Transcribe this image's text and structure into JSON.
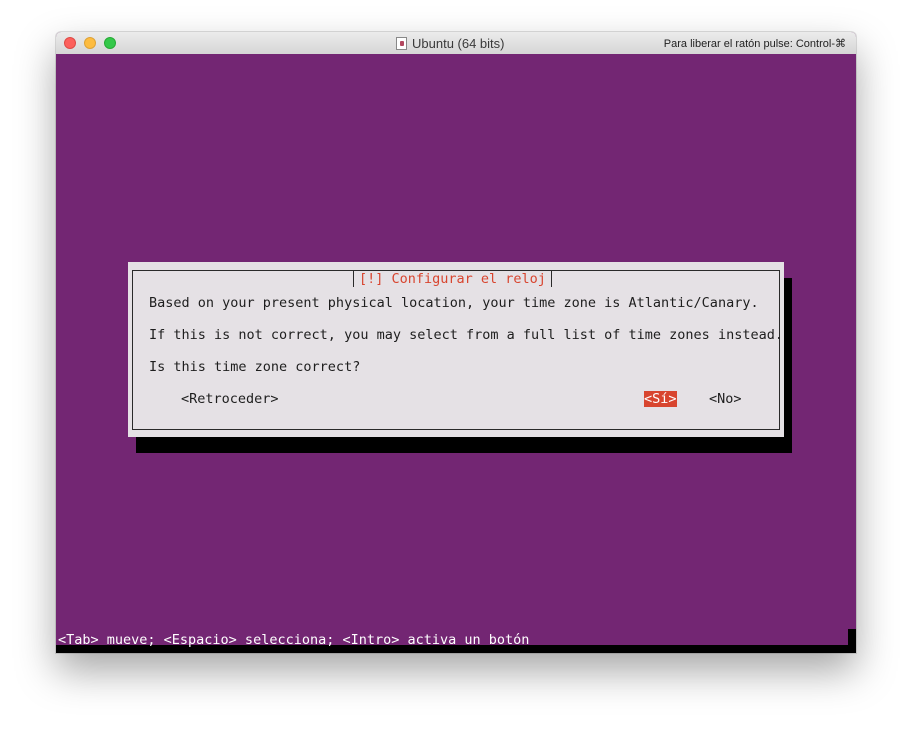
{
  "window": {
    "title": "Ubuntu (64 bits)",
    "hint": "Para liberar el ratón pulse: Control-⌘"
  },
  "dialog": {
    "title": "[!] Configurar el reloj",
    "lines": [
      "Based on your present physical location, your time zone is Atlantic/Canary.",
      "If this is not correct, you may select from a full list of time zones instead.",
      "Is this time zone correct?"
    ],
    "buttons": {
      "back": "<Retroceder>",
      "yes": "<Sí>",
      "no": "<No>"
    },
    "selected_button": "yes"
  },
  "statusbar": {
    "text": "<Tab> mueve; <Espacio> selecciona; <Intro> activa un botón"
  },
  "colors": {
    "background": "#732673",
    "dialog_bg": "#e5e1e5",
    "accent": "#d8452f"
  }
}
